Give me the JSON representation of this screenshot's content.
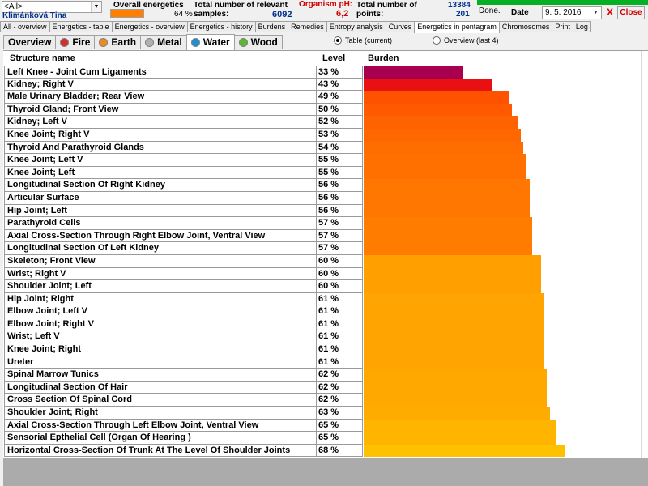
{
  "header": {
    "filter_select": "<All>",
    "patient_name": "Klimánková Tina",
    "overall_label": "Overall energetics",
    "overall_value": "64 %",
    "samples_label_1": "Total number of relevant",
    "samples_label_2": "samples:",
    "samples_value": "6092",
    "ph_label": "Organism pH:",
    "ph_value": "6,2",
    "points_label_1": "Total number of",
    "points_label_2": "points:",
    "points_value_1": "13384",
    "points_value_2": "201",
    "progress": 1.0,
    "done_label": "Done.",
    "date_label": "Date",
    "date_value": "9. 5. 2016",
    "close_x": "X",
    "close_label": "Close"
  },
  "main_tabs": [
    {
      "label": "All - overview",
      "active": false
    },
    {
      "label": "Energetics - table",
      "active": false
    },
    {
      "label": "Energetics - overview",
      "active": false
    },
    {
      "label": "Energetics - history",
      "active": false
    },
    {
      "label": "Burdens",
      "active": false
    },
    {
      "label": "Remedies",
      "active": false
    },
    {
      "label": "Entropy analysis",
      "active": false
    },
    {
      "label": "Curves",
      "active": false
    },
    {
      "label": "Energetics in pentagram",
      "active": true
    },
    {
      "label": "Chromosomes",
      "active": false
    },
    {
      "label": "Print",
      "active": false
    },
    {
      "label": "Log",
      "active": false
    }
  ],
  "element_tabs": [
    {
      "label": "Overview",
      "dot": null,
      "active": false
    },
    {
      "label": "Fire",
      "dot": "#d32f2f",
      "active": false
    },
    {
      "label": "Earth",
      "dot": "#f08a1e",
      "active": false
    },
    {
      "label": "Metal",
      "dot": "#b0b0b0",
      "active": false
    },
    {
      "label": "Water",
      "dot": "#1e90d2",
      "active": true
    },
    {
      "label": "Wood",
      "dot": "#5cb82e",
      "active": false
    }
  ],
  "view_options": {
    "table_label": "Table (current)",
    "overview_label": "Overview (last 4)",
    "selected": "table"
  },
  "table": {
    "col_structure": "Structure name",
    "col_level": "Level",
    "col_burden": "Burden",
    "rows": [
      {
        "name": "Left Knee - Joint Cum Ligaments",
        "level": "33 %",
        "burden": 33,
        "color": "#a8004f"
      },
      {
        "name": "Kidney; Right V",
        "level": "43 %",
        "burden": 43,
        "color": "#e81010"
      },
      {
        "name": "Male Urinary Bladder; Rear View",
        "level": "49 %",
        "burden": 49,
        "color": "#ff5200"
      },
      {
        "name": "Thyroid Gland; Front View",
        "level": "50 %",
        "burden": 50,
        "color": "#ff5a00"
      },
      {
        "name": "Kidney; Left V",
        "level": "52 %",
        "burden": 52,
        "color": "#ff6200"
      },
      {
        "name": "Knee Joint; Right V",
        "level": "53 %",
        "burden": 53,
        "color": "#ff6800"
      },
      {
        "name": "Thyroid And Parathyroid Glands",
        "level": "54 %",
        "burden": 54,
        "color": "#ff6c00"
      },
      {
        "name": "Knee Joint; Left V",
        "level": "55 %",
        "burden": 55,
        "color": "#ff7000"
      },
      {
        "name": "Knee Joint; Left",
        "level": "55 %",
        "burden": 55,
        "color": "#ff7000"
      },
      {
        "name": "Longitudinal Section Of Right Kidney",
        "level": "56 %",
        "burden": 56,
        "color": "#ff7600"
      },
      {
        "name": "Articular Surface",
        "level": "56 %",
        "burden": 56,
        "color": "#ff7600"
      },
      {
        "name": "Hip Joint; Left",
        "level": "56 %",
        "burden": 56,
        "color": "#ff7600"
      },
      {
        "name": "Parathyroid Cells",
        "level": "57 %",
        "burden": 57,
        "color": "#ff7c00"
      },
      {
        "name": "Axial Cross-Section Through Right Elbow Joint, Ventral View",
        "level": "57 %",
        "burden": 57,
        "color": "#ff7c00"
      },
      {
        "name": "Longitudinal Section Of Left Kidney",
        "level": "57 %",
        "burden": 57,
        "color": "#ff7c00"
      },
      {
        "name": "Skeleton; Front View",
        "level": "60 %",
        "burden": 60,
        "color": "#ffa000"
      },
      {
        "name": "Wrist; Right V",
        "level": "60 %",
        "burden": 60,
        "color": "#ffa000"
      },
      {
        "name": "Shoulder Joint; Left",
        "level": "60 %",
        "burden": 60,
        "color": "#ffa000"
      },
      {
        "name": "Hip Joint; Right",
        "level": "61 %",
        "burden": 61,
        "color": "#ffa400"
      },
      {
        "name": "Elbow Joint; Left V",
        "level": "61 %",
        "burden": 61,
        "color": "#ffa400"
      },
      {
        "name": "Elbow Joint; Right V",
        "level": "61 %",
        "burden": 61,
        "color": "#ffa400"
      },
      {
        "name": "Wrist; Left V",
        "level": "61 %",
        "burden": 61,
        "color": "#ffa400"
      },
      {
        "name": "Knee Joint; Right",
        "level": "61 %",
        "burden": 61,
        "color": "#ffa400"
      },
      {
        "name": "Ureter",
        "level": "61 %",
        "burden": 61,
        "color": "#ffa400"
      },
      {
        "name": "Spinal Marrow Tunics",
        "level": "62 %",
        "burden": 62,
        "color": "#ffa800"
      },
      {
        "name": "Longitudinal Section Of Hair",
        "level": "62 %",
        "burden": 62,
        "color": "#ffa800"
      },
      {
        "name": "Cross Section Of Spinal Cord",
        "level": "62 %",
        "burden": 62,
        "color": "#ffa800"
      },
      {
        "name": "Shoulder Joint; Right",
        "level": "63 %",
        "burden": 63,
        "color": "#ffac00"
      },
      {
        "name": "Axial Cross-Section Through Left Elbow Joint, Ventral View",
        "level": "65 %",
        "burden": 65,
        "color": "#ffb400"
      },
      {
        "name": "Sensorial Epthelial Cell (Organ Of Hearing )",
        "level": "65 %",
        "burden": 65,
        "color": "#ffb400"
      },
      {
        "name": "Horizontal Cross-Section Of Trunk At The Level Of Shoulder Joints",
        "level": "68 %",
        "burden": 68,
        "color": "#ffc000"
      }
    ]
  }
}
